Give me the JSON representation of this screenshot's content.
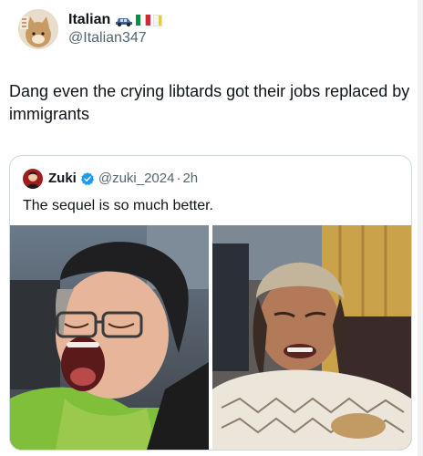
{
  "author": {
    "display_name": "Italian",
    "handle": "@Italian347"
  },
  "tweet": {
    "text": "Dang even the crying libtards got their jobs replaced by immigrants"
  },
  "quoted": {
    "display_name": "Zuki",
    "handle": "@zuki_2024",
    "separator": "·",
    "time": "2h",
    "text": "The sequel is so much better."
  },
  "icons": {
    "author_avatar": "cat-avatar-icon",
    "flags": [
      "car-icon",
      "italy-flag-icon",
      "flag-icon"
    ],
    "verified": "verified-badge-icon",
    "quoted_avatar": "avatar-icon"
  },
  "colors": {
    "verified_blue": "#1d9bf0",
    "secondary_text": "#536471",
    "border": "#cfd9de"
  }
}
